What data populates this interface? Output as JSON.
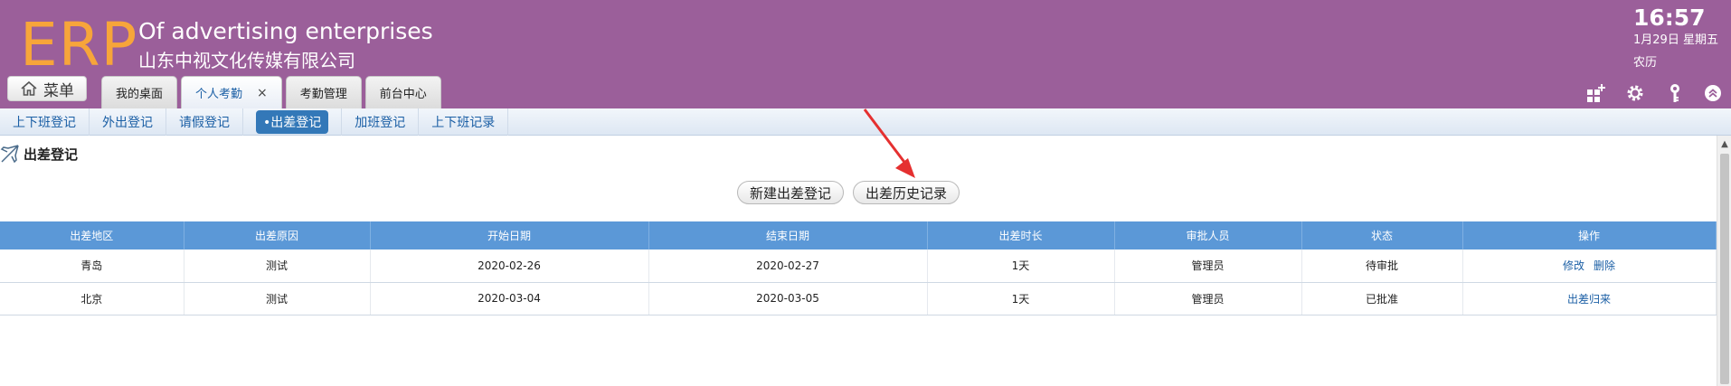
{
  "header": {
    "logo": "ERP",
    "company_en": "Of advertising enterprises",
    "company_cn": "山东中视文化传媒有限公司",
    "time": "16:57",
    "date": "1月29日 星期五",
    "lunar": "农历",
    "menu_label": "菜单",
    "bg_color": "#9b5f9a",
    "logo_color": "#f7a53a"
  },
  "tabs": [
    {
      "label": "我的桌面"
    },
    {
      "label": "个人考勤",
      "active": true,
      "closable": true,
      "close": "×"
    },
    {
      "label": "考勤管理"
    },
    {
      "label": "前台中心"
    }
  ],
  "header_icons": [
    "add-window-icon",
    "gear-icon",
    "key-icon",
    "collapse-icon"
  ],
  "subnav": [
    {
      "label": "上下班登记"
    },
    {
      "label": "外出登记"
    },
    {
      "label": "请假登记"
    },
    {
      "label": "•出差登记",
      "active": true
    },
    {
      "label": "加班登记"
    },
    {
      "label": "上下班记录"
    }
  ],
  "section": {
    "title": "出差登记",
    "icon": "airplane-icon"
  },
  "actions": {
    "new_label": "新建出差登记",
    "history_label": "出差历史记录"
  },
  "table": {
    "headers": [
      "出差地区",
      "出差原因",
      "开始日期",
      "结束日期",
      "出差时长",
      "审批人员",
      "状态",
      "操作"
    ],
    "rows": [
      {
        "region": "青岛",
        "reason": "测试",
        "start": "2020-02-26",
        "end": "2020-02-27",
        "duration": "1天",
        "approver": "管理员",
        "status": "待审批",
        "status_color": "#222222",
        "ops": [
          "修改",
          "删除"
        ]
      },
      {
        "region": "北京",
        "reason": "测试",
        "start": "2020-03-04",
        "end": "2020-03-05",
        "duration": "1天",
        "approver": "管理员",
        "status": "已批准",
        "status_color": "#2a9a2a",
        "ops": [
          "出差归来"
        ]
      }
    ],
    "header_color": "#5b98d7"
  },
  "annotation": {
    "arrow_color": "#e53030"
  }
}
